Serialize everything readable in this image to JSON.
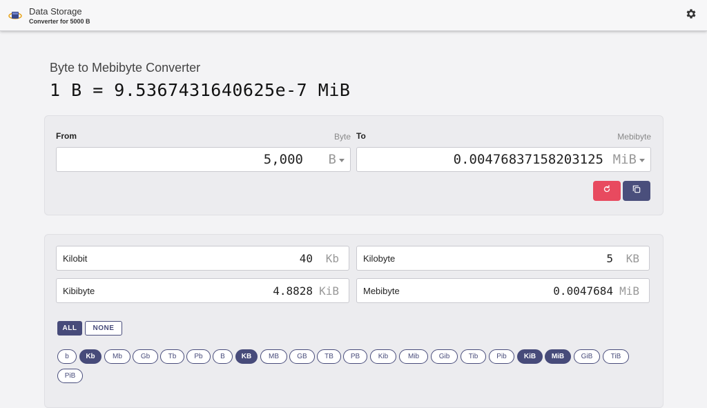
{
  "header": {
    "title": "Data Storage",
    "subtitle": "Converter for 5000 B"
  },
  "converter": {
    "title": "Byte to Mebibyte Converter",
    "result": "1 B = 9.5367431640625e-7 MiB",
    "from": {
      "label": "From",
      "unit_name": "Byte",
      "value": "5,000",
      "unit": "B"
    },
    "to": {
      "label": "To",
      "unit_name": "Mebibyte",
      "value": "0.00476837158203125",
      "unit": "MiB"
    }
  },
  "results": [
    {
      "label": "Kilobit",
      "value": "40",
      "unit": "Kb"
    },
    {
      "label": "Kilobyte",
      "value": "5",
      "unit": "KB"
    },
    {
      "label": "Kibibyte",
      "value": "4.8828",
      "unit": "KiB"
    },
    {
      "label": "Mebibyte",
      "value": "0.0047684",
      "unit": "MiB"
    }
  ],
  "selection": {
    "all_label": "ALL",
    "none_label": "NONE"
  },
  "chips": [
    {
      "label": "b",
      "selected": false
    },
    {
      "label": "Kb",
      "selected": true
    },
    {
      "label": "Mb",
      "selected": false
    },
    {
      "label": "Gb",
      "selected": false
    },
    {
      "label": "Tb",
      "selected": false
    },
    {
      "label": "Pb",
      "selected": false
    },
    {
      "label": "B",
      "selected": false
    },
    {
      "label": "KB",
      "selected": true
    },
    {
      "label": "MB",
      "selected": false
    },
    {
      "label": "GB",
      "selected": false
    },
    {
      "label": "TB",
      "selected": false
    },
    {
      "label": "PB",
      "selected": false
    },
    {
      "label": "Kib",
      "selected": false
    },
    {
      "label": "Mib",
      "selected": false
    },
    {
      "label": "Gib",
      "selected": false
    },
    {
      "label": "Tib",
      "selected": false
    },
    {
      "label": "Pib",
      "selected": false
    },
    {
      "label": "KiB",
      "selected": true
    },
    {
      "label": "MiB",
      "selected": true
    },
    {
      "label": "GiB",
      "selected": false
    },
    {
      "label": "TiB",
      "selected": false
    },
    {
      "label": "PiB",
      "selected": false
    }
  ],
  "colors": {
    "accent": "#474b7a",
    "reset": "#e84a5f"
  },
  "icons": {
    "logo": "storage-logo-icon",
    "settings": "gear-icon",
    "reset": "refresh-icon",
    "copy": "copy-icon",
    "dropdown": "caret-down-icon"
  }
}
